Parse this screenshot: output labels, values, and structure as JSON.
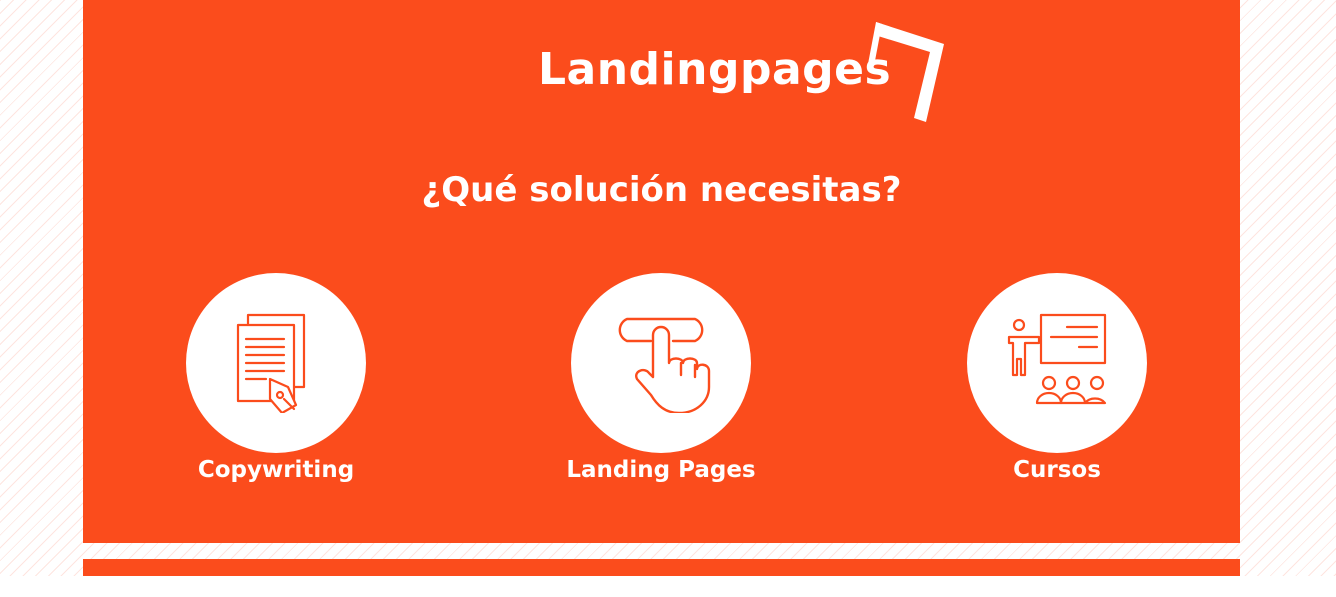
{
  "brand": {
    "logo_text": "Landingpages",
    "accent_color": "#fb4c1c"
  },
  "heading": "¿Qué solución necesitas?",
  "services": [
    {
      "label": "Copywriting",
      "icon": "document-pen-icon"
    },
    {
      "label": "Landing Pages",
      "icon": "touch-button-icon"
    },
    {
      "label": "Cursos",
      "icon": "presentation-class-icon"
    }
  ]
}
